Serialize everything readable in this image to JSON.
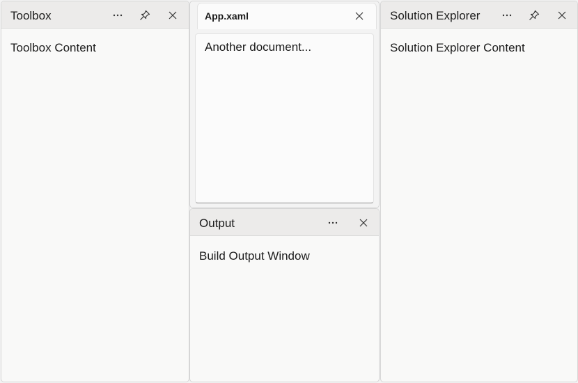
{
  "toolbox": {
    "title": "Toolbox",
    "content": "Toolbox Content"
  },
  "document": {
    "tab_label": "App.xaml",
    "text": "Another document..."
  },
  "output": {
    "title": "Output",
    "content": "Build Output Window"
  },
  "solution_explorer": {
    "title": "Solution Explorer",
    "content": "Solution Explorer Content"
  },
  "icons": {
    "more": "more-options-icon",
    "pin": "pin-icon",
    "close": "close-icon"
  },
  "colors": {
    "header_bg": "#ecebea",
    "pane_bg": "#f9f9f8",
    "border": "#d6d6d6"
  }
}
